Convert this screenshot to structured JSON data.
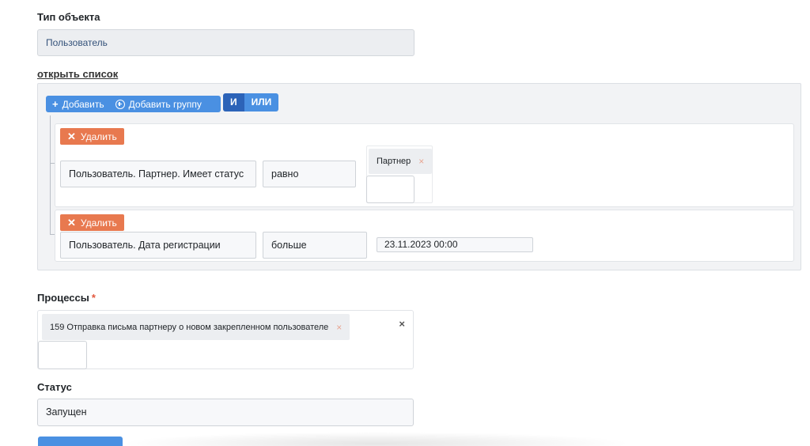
{
  "object_type": {
    "label": "Тип объекта",
    "value": "Пользователь"
  },
  "open_list_link": "открыть список",
  "builder": {
    "add_label": "Добавить",
    "add_group_label": "Добавить группу",
    "and_label": "И",
    "or_label": "ИЛИ",
    "rules": [
      {
        "delete_label": "Удалить",
        "field": "Пользователь. Партнер. Имеет статус",
        "operator": "равно",
        "tag_value": "Партнер",
        "tag_remove": "×"
      },
      {
        "delete_label": "Удалить",
        "field": "Пользователь. Дата регистрации",
        "operator": "больше",
        "date_value": "23.11.2023 00:00"
      }
    ]
  },
  "processes": {
    "label": "Процессы",
    "required_mark": "*",
    "tag_value": "159 Отправка письма партнеру о новом закрепленном пользователе",
    "tag_remove": "×",
    "clear": "×"
  },
  "status": {
    "label": "Статус",
    "value": "Запущен"
  },
  "colors": {
    "primary": "#4a90e2",
    "primary_dark": "#2c63b8",
    "danger": "#e8794f",
    "required": "#e2583e"
  },
  "icons": {
    "add": "plus-icon",
    "add_group": "plus-circle-icon",
    "delete": "close-icon",
    "tag_remove": "close-icon",
    "clear": "close-icon"
  }
}
